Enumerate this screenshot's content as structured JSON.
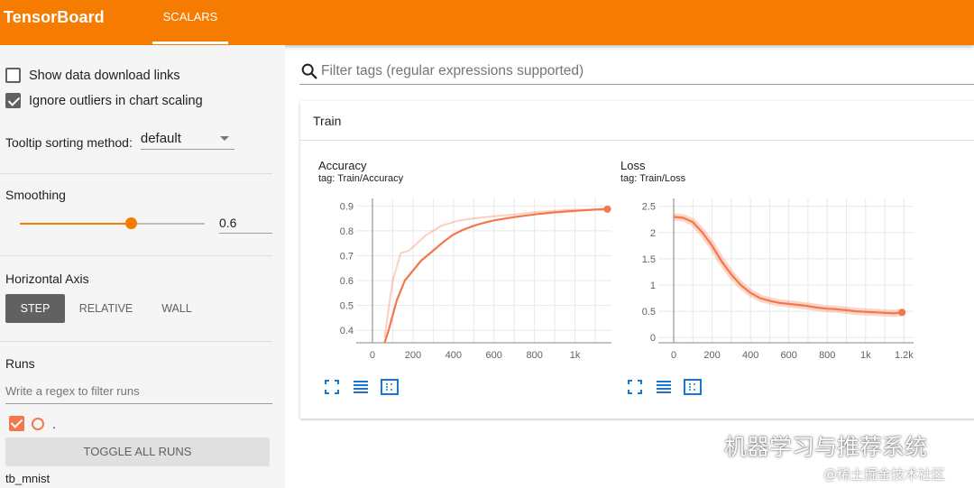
{
  "header": {
    "brand": "TensorBoard",
    "tab": "SCALARS",
    "accent": "#f57c00"
  },
  "sidebar": {
    "show_download": {
      "label": "Show data download links",
      "checked": false
    },
    "ignore_outliers": {
      "label": "Ignore outliers in chart scaling",
      "checked": true
    },
    "tooltip": {
      "label": "Tooltip sorting method:",
      "value": "default"
    },
    "smoothing": {
      "title": "Smoothing",
      "value": "0.6",
      "fraction": 0.6
    },
    "horizontal_axis": {
      "title": "Horizontal Axis",
      "options": [
        "STEP",
        "RELATIVE",
        "WALL"
      ],
      "selected": "STEP"
    },
    "runs": {
      "title": "Runs",
      "filter_placeholder": "Write a regex to filter runs",
      "run_name": ".",
      "toggle_label": "TOGGLE ALL RUNS",
      "run_label": "tb_mnist",
      "run_color": "#f4774b"
    }
  },
  "search": {
    "placeholder": "Filter tags (regular expressions supported)",
    "icon": "search-icon"
  },
  "card": {
    "title": "Train"
  },
  "chart_data": [
    {
      "type": "line",
      "title": "Accuracy",
      "tag": "tag: Train/Accuracy",
      "xlim": [
        -80,
        1180
      ],
      "ylim": [
        0.35,
        0.93
      ],
      "x_ticks": [
        {
          "v": 0,
          "label": "0"
        },
        {
          "v": 200,
          "label": "200"
        },
        {
          "v": 400,
          "label": "400"
        },
        {
          "v": 600,
          "label": "600"
        },
        {
          "v": 800,
          "label": "800"
        },
        {
          "v": 1000,
          "label": "1k"
        }
      ],
      "y_ticks": [
        {
          "v": 0.4,
          "label": "0.4"
        },
        {
          "v": 0.5,
          "label": "0.5"
        },
        {
          "v": 0.6,
          "label": "0.6"
        },
        {
          "v": 0.7,
          "label": "0.7"
        },
        {
          "v": 0.8,
          "label": "0.8"
        },
        {
          "v": 0.9,
          "label": "0.9"
        }
      ],
      "series": [
        {
          "role": "raw",
          "x": [
            60,
            100,
            140,
            180,
            220,
            260,
            300,
            340,
            380,
            420,
            460,
            500,
            560,
            620,
            700,
            800,
            900,
            1000,
            1100,
            1160
          ],
          "y": [
            0.37,
            0.6,
            0.71,
            0.72,
            0.75,
            0.78,
            0.8,
            0.82,
            0.83,
            0.84,
            0.845,
            0.85,
            0.855,
            0.86,
            0.865,
            0.875,
            0.88,
            0.885,
            0.885,
            0.89
          ]
        },
        {
          "role": "smoothed",
          "x": [
            60,
            80,
            100,
            120,
            140,
            160,
            200,
            240,
            300,
            350,
            400,
            450,
            500,
            550,
            600,
            700,
            800,
            900,
            1000,
            1100,
            1160
          ],
          "y": [
            0.35,
            0.4,
            0.46,
            0.52,
            0.56,
            0.6,
            0.64,
            0.68,
            0.72,
            0.755,
            0.785,
            0.805,
            0.82,
            0.832,
            0.842,
            0.855,
            0.866,
            0.874,
            0.88,
            0.885,
            0.887
          ]
        }
      ]
    },
    {
      "type": "line",
      "title": "Loss",
      "tag": "tag: Train/Loss",
      "xlim": [
        -80,
        1250
      ],
      "ylim": [
        -0.1,
        2.65
      ],
      "x_ticks": [
        {
          "v": 0,
          "label": "0"
        },
        {
          "v": 200,
          "label": "200"
        },
        {
          "v": 400,
          "label": "400"
        },
        {
          "v": 600,
          "label": "600"
        },
        {
          "v": 800,
          "label": "800"
        },
        {
          "v": 1000,
          "label": "1k"
        },
        {
          "v": 1200,
          "label": "1.2k"
        }
      ],
      "y_ticks": [
        {
          "v": 0,
          "label": "0"
        },
        {
          "v": 0.5,
          "label": "0.5"
        },
        {
          "v": 1,
          "label": "1"
        },
        {
          "v": 1.5,
          "label": "1.5"
        },
        {
          "v": 2,
          "label": "2"
        },
        {
          "v": 2.5,
          "label": "2.5"
        }
      ],
      "series": [
        {
          "role": "smoothed",
          "x": [
            0,
            50,
            100,
            150,
            200,
            250,
            300,
            350,
            400,
            450,
            500,
            550,
            600,
            650,
            700,
            750,
            800,
            850,
            900,
            950,
            1000,
            1050,
            1100,
            1150,
            1190
          ],
          "y": [
            2.3,
            2.28,
            2.2,
            2.0,
            1.75,
            1.45,
            1.2,
            1.0,
            0.85,
            0.75,
            0.7,
            0.66,
            0.64,
            0.62,
            0.6,
            0.57,
            0.55,
            0.54,
            0.52,
            0.5,
            0.49,
            0.48,
            0.47,
            0.46,
            0.48
          ]
        }
      ]
    }
  ]
}
